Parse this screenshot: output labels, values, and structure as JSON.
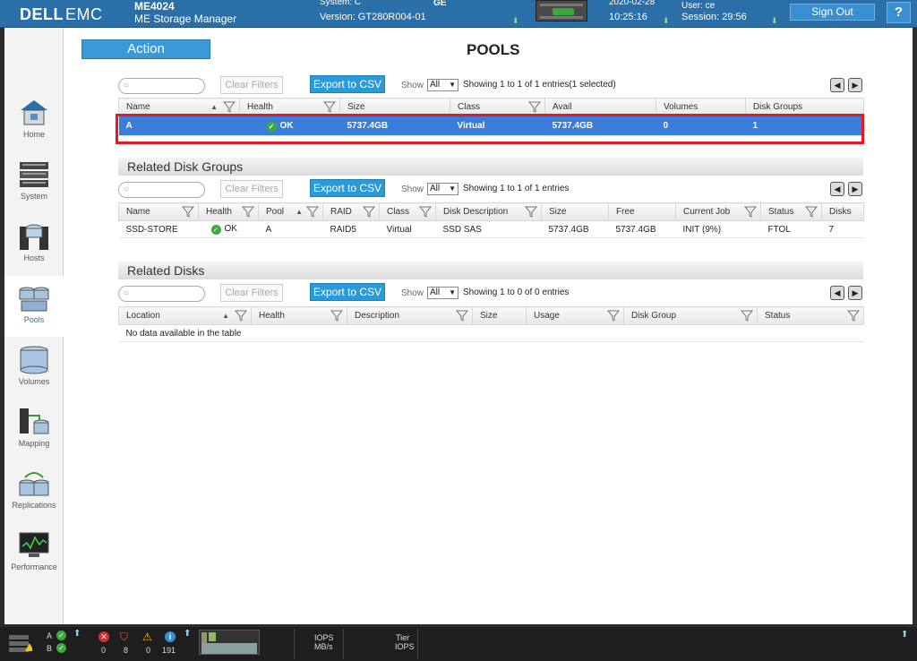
{
  "topbar": {
    "logo_dell": "DELL",
    "logo_emc": "EMC",
    "system_name": "ME4024",
    "app_name": "ME Storage Manager",
    "system_label": "System: C",
    "ge_text": "GE",
    "version": "Version: GT280R004-01",
    "date": "2020-02-28",
    "time": "10:25:16",
    "user": "User: ce",
    "session": "Session: 29:56",
    "sign_out": "Sign Out",
    "help": "?"
  },
  "sidebar": {
    "items": [
      {
        "label": "Home",
        "icon": "home-icon"
      },
      {
        "label": "System",
        "icon": "system-icon"
      },
      {
        "label": "Hosts",
        "icon": "hosts-icon"
      },
      {
        "label": "Pools",
        "icon": "pools-icon",
        "active": true
      },
      {
        "label": "Volumes",
        "icon": "volumes-icon"
      },
      {
        "label": "Mapping",
        "icon": "mapping-icon"
      },
      {
        "label": "Replications",
        "icon": "replications-icon"
      },
      {
        "label": "Performance",
        "icon": "performance-icon"
      }
    ]
  },
  "main": {
    "action_label": "Action",
    "page_title": "POOLS",
    "controls": {
      "clear_filters": "Clear Filters",
      "export_csv": "Export to CSV",
      "show_label": "Show",
      "show_value": "All"
    },
    "pools_table": {
      "entries_text": "Showing 1 to 1 of 1 entries(1 selected)",
      "columns": [
        "Name",
        "Health",
        "Size",
        "Class",
        "Avail",
        "Volumes",
        "Disk Groups"
      ],
      "rows": [
        {
          "name": "A",
          "health": "OK",
          "size": "5737.4GB",
          "class": "Virtual",
          "avail": "5737.4GB",
          "volumes": "0",
          "disk_groups": "1"
        }
      ]
    },
    "disk_groups": {
      "section_title": "Related Disk Groups",
      "entries_text": "Showing 1 to 1 of 1 entries",
      "columns": [
        "Name",
        "Health",
        "Pool",
        "RAID",
        "Class",
        "Disk Description",
        "Size",
        "Free",
        "Current Job",
        "Status",
        "Disks"
      ],
      "rows": [
        {
          "name": "SSD-STORE",
          "health": "OK",
          "pool": "A",
          "raid": "RAID5",
          "class": "Virtual",
          "desc": "SSD SAS",
          "size": "5737.4GB",
          "free": "5737.4GB",
          "job": "INIT (9%)",
          "status": "FTOL",
          "disks": "7"
        }
      ]
    },
    "disks": {
      "section_title": "Related Disks",
      "entries_text": "Showing 1 to 0 of 0 entries",
      "columns": [
        "Location",
        "Health",
        "Description",
        "Size",
        "Usage",
        "Disk Group",
        "Status"
      ],
      "empty_text": "No data available in the table"
    }
  },
  "bottombar": {
    "ctrl_a": "A",
    "ctrl_b": "B",
    "count_critical": "0",
    "count_error": "8",
    "count_warning": "0",
    "count_info": "191",
    "iops_label": "IOPS",
    "mbs_label": "MB/s",
    "tier_label": "Tier",
    "tier_iops_label": "IOPS"
  },
  "colors": {
    "accent": "#2a6fa8",
    "selected_row": "#3a7ddb",
    "highlight": "#e01b24",
    "ok": "#3caa3c"
  }
}
